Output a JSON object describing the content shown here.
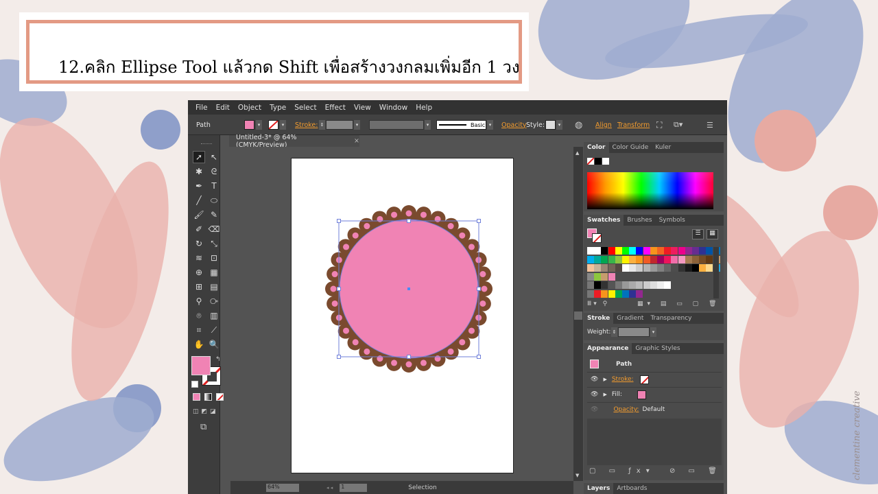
{
  "slide": {
    "title": "12.คลิก Ellipse Tool แล้วกด Shift เพื่อสร้างวงกลมเพิ่มอีก 1 วง",
    "signature": "clementine creative"
  },
  "menu": [
    "File",
    "Edit",
    "Object",
    "Type",
    "Select",
    "Effect",
    "View",
    "Window",
    "Help"
  ],
  "control": {
    "selection_type": "Path",
    "stroke_label": "Stroke:",
    "brush_label": "Basic",
    "opacity_label": "Opacity",
    "style_label": "Style:",
    "align_label": "Align",
    "transform_label": "Transform"
  },
  "document": {
    "tab_title": "Untitled-3* @ 64% (CMYK/Preview)",
    "tab_close": "×",
    "zoom": "64%",
    "page": "1",
    "status": "Selection"
  },
  "panels": {
    "color_tabs": [
      "Color",
      "Color Guide",
      "Kuler"
    ],
    "swatch_tabs": [
      "Swatches",
      "Brushes",
      "Symbols"
    ],
    "stroke_tabs": [
      "Stroke",
      "Gradient",
      "Transparency"
    ],
    "weight_label": "Weight:",
    "appearance_tabs": [
      "Appearance",
      "Graphic Styles"
    ],
    "appearance_title": "Path",
    "appearance_stroke": "Stroke:",
    "appearance_fill": "Fill:",
    "appearance_opacity_label": "Opacity:",
    "appearance_opacity_value": "Default",
    "bottom_tabs": [
      "Layers",
      "Artboards"
    ]
  },
  "colors": {
    "fill": "#f083b4",
    "scallop": "#7a4a2e",
    "accent": "#f39c2e",
    "title_border": "#e39a84"
  }
}
